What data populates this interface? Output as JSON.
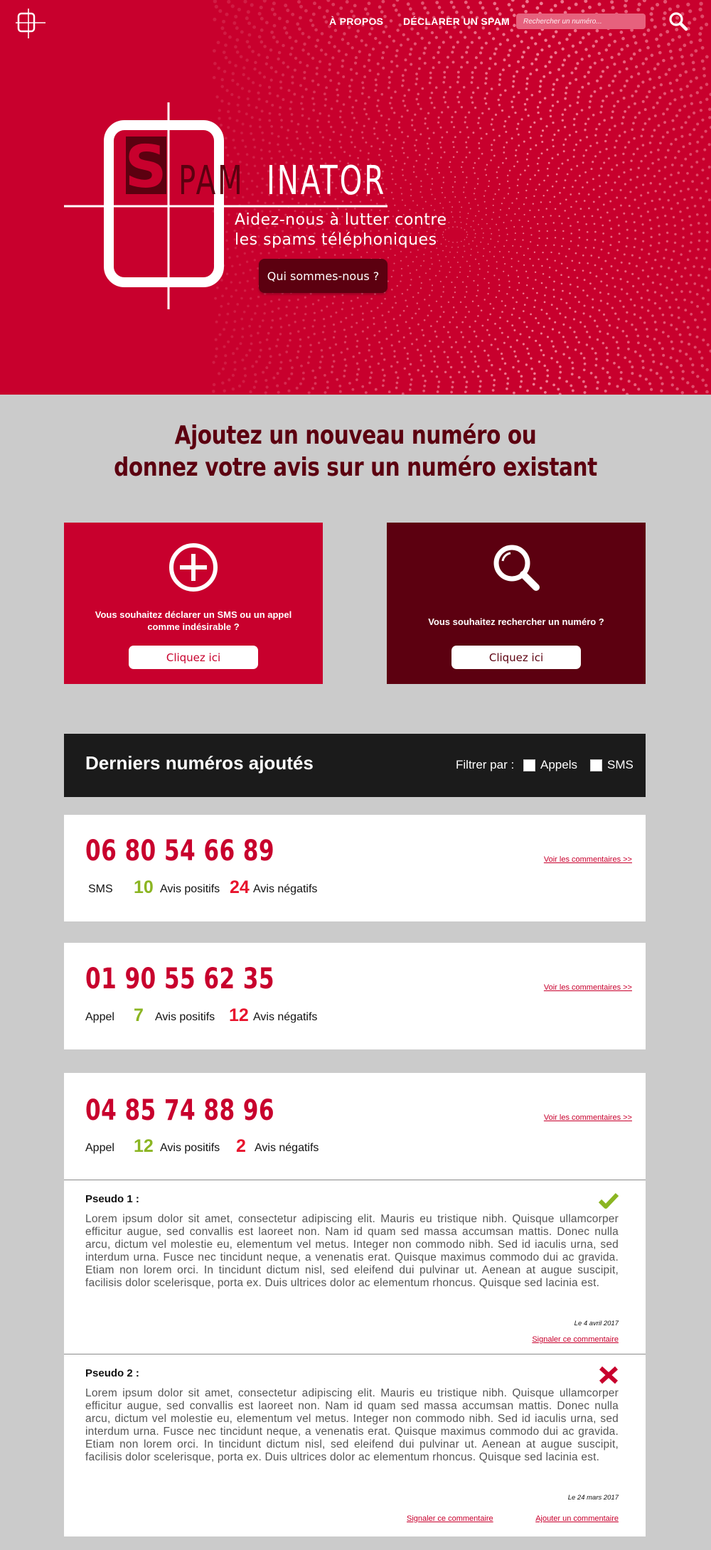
{
  "header": {
    "nav": [
      "À PROPOS",
      "DÉCLARER UN SPAM"
    ],
    "search_placeholder": "Rechercher un numéro...",
    "colors": {
      "primary": "#c8002d",
      "dark": "#5c0010"
    }
  },
  "hero": {
    "logo_initial": "S",
    "logo_pam": "PAM",
    "logo_inator": "INATOR",
    "tagline": [
      "Aidez-nous à lutter contre",
      "les spams téléphoniques"
    ],
    "button": "Qui sommes-nous ?"
  },
  "intro": {
    "title": [
      "Ajoutez un nouveau numéro ou",
      "donnez votre avis sur un numéro existant"
    ]
  },
  "cards": {
    "declare": {
      "icon": "plus-circle-icon",
      "text": "Vous souhaitez déclarer un SMS ou un appel comme indésirable ?",
      "button": "Cliquez ici"
    },
    "search": {
      "icon": "search-icon",
      "text": "Vous souhaitez rechercher un numéro ?",
      "button": "Cliquez ici"
    }
  },
  "latest": {
    "title": "Derniers numéros ajoutés",
    "filter_label": "Filtrer par :",
    "filters": [
      "Appels",
      "SMS"
    ]
  },
  "numbers": [
    {
      "phone": "06 80 54 66 89",
      "type": "SMS",
      "positive": "10",
      "positive_label": "Avis positifs",
      "negative": "24",
      "negative_label": "Avis négatifs",
      "link": "Voir les commentaires >>"
    },
    {
      "phone": "01 90 55 62 35",
      "type": "Appel",
      "positive": "7",
      "positive_label": "Avis positifs",
      "negative": "12",
      "negative_label": "Avis négatifs",
      "link": "Voir les commentaires >>"
    },
    {
      "phone": "04 85 74 88 96",
      "type": "Appel",
      "positive": "12",
      "positive_label": "Avis positifs",
      "negative": "2",
      "negative_label": "Avis négatifs",
      "link": "Voir les commentaires >>"
    }
  ],
  "comments": [
    {
      "pseudo": "Pseudo 1 :",
      "verdict": "check-icon",
      "text": "Lorem ipsum dolor sit amet, consectetur adipiscing elit. Mauris eu tristique nibh. Quisque ullamcorper efficitur augue, sed convallis est laoreet non. Nam id quam sed massa accumsan mattis. Donec nulla arcu, dictum vel molestie eu, elementum vel metus. Integer non commodo nibh. Sed id iaculis urna, sed interdum urna. Fusce nec tincidunt neque, a venenatis erat. Quisque maximus commodo dui ac gravida. Etiam non lorem orci. In tincidunt dictum nisl, sed eleifend dui pulvinar ut. Aenean at augue suscipit, facilisis dolor scelerisque, porta ex. Duis ultrices dolor ac elementum rhoncus. Quisque sed lacinia est.",
      "date": "Le 4 avril 2017",
      "report_link": "Signaler ce commentaire"
    },
    {
      "pseudo": "Pseudo 2 :",
      "verdict": "cross-icon",
      "text": "Lorem ipsum dolor sit amet, consectetur adipiscing elit. Mauris eu tristique nibh. Quisque ullamcorper efficitur augue, sed convallis est laoreet non. Nam id quam sed massa accumsan mattis. Donec nulla arcu, dictum vel molestie eu, elementum vel metus. Integer non commodo nibh. Sed id iaculis urna, sed interdum urna. Fusce nec tincidunt neque, a venenatis erat. Quisque maximus commodo dui ac gravida. Etiam non lorem orci. In tincidunt dictum nisl, sed eleifend dui pulvinar ut. Aenean at augue suscipit, facilisis dolor scelerisque, porta ex. Duis ultrices dolor ac elementum rhoncus. Quisque sed lacinia est.",
      "date": "Le 24 mars 2017",
      "report_link": "Signaler ce commentaire",
      "add_link": "Ajouter un commentaire"
    }
  ]
}
